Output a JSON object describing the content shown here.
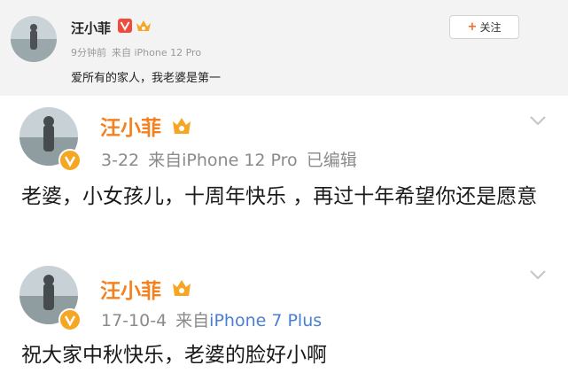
{
  "repost": {
    "name": "汪小菲",
    "time": "9分钟前",
    "source": "来自 iPhone 12 Pro",
    "text": "爱所有的家人，我老婆是第一",
    "follow_label": "关注",
    "follow_plus": "+"
  },
  "posts": [
    {
      "name": "汪小菲",
      "date": "3-22",
      "source_prefix": "来自",
      "device": "iPhone 12 Pro",
      "edited": "已编辑",
      "body": "老婆，小女孩儿，十周年快乐 ，再过十年希望你还是愿意"
    },
    {
      "name": "汪小菲",
      "date": "17-10-4",
      "source_prefix": "来自",
      "device": "iPhone 7 Plus",
      "body": "祝大家中秋快乐，老婆的脸好小啊"
    }
  ],
  "icons": {
    "verified": "verified-badge-icon",
    "vip": "vip-crown-badge-icon",
    "more": "chevron-down-icon"
  },
  "colors": {
    "name_orange": "#f4811f",
    "badge_orange": "#f5a623",
    "device_link_blue": "#4a7fcf",
    "meta_gray": "#8a8a8a",
    "header_bg": "#f3f3f3"
  }
}
